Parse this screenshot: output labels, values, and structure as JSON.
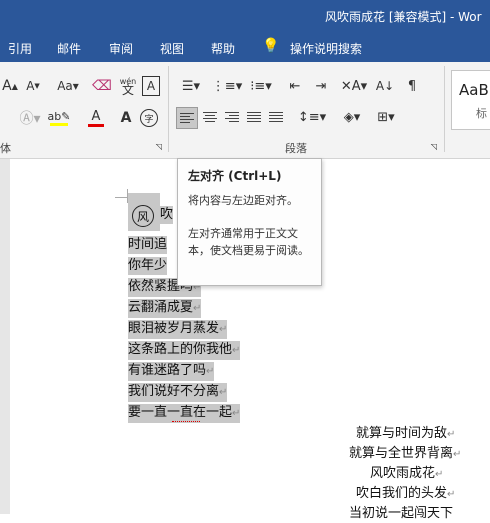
{
  "window": {
    "title": "风吹雨成花 [兼容模式] - Wor"
  },
  "menu": [
    "引用",
    "邮件",
    "审阅",
    "视图",
    "帮助",
    "操作说明搜索"
  ],
  "ribbon": {
    "font_group_label": "体",
    "paragraph_group_label": "段落",
    "style_preview": "AaB",
    "style_name": "标"
  },
  "tooltip": {
    "title": "左对齐 (Ctrl+L)",
    "desc1": "将内容与左边距对齐。",
    "desc2": "左对齐通常用于正文文本，使文档更易于阅读。"
  },
  "document": {
    "drop_char": "风",
    "first_line_rest": "吹",
    "left_lines": [
      "时间追",
      "你年少",
      "依然紧握吗",
      "云翻涌成夏",
      "眼泪被岁月蒸发",
      "这条路上的你我他",
      "有谁迷路了吗",
      "我们说好不分离",
      "要一直一直在一起"
    ],
    "right_lines": [
      "就算与时间为敌",
      "就算与全世界背离",
      "风吹雨成花",
      "吹白我们的头发",
      "当初说一起闯天下"
    ],
    "para_mark": "↵"
  },
  "colors": {
    "title_bar": "#2b579a",
    "highlight": "#c8c8c8",
    "font_color_red": "#e00000",
    "highlight_yellow": "#ffff00"
  }
}
